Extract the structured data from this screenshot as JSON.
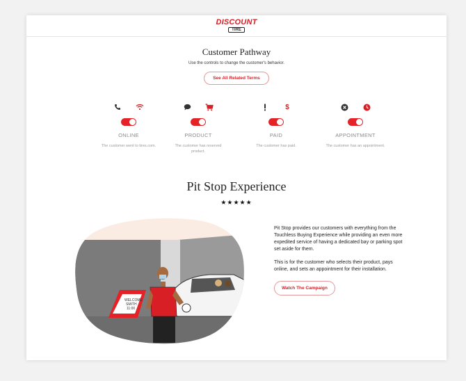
{
  "brand": {
    "logo_top": "DISCOUNT",
    "logo_bottom": "TIRE",
    "accent": "#d91f26"
  },
  "pathway": {
    "title": "Customer Pathway",
    "subtitle": "Use the controls to change the customer's behavior.",
    "terms_button": "See All Related Terms"
  },
  "stages": [
    {
      "label": "ONLINE",
      "desc": "The customer went to tires.com.",
      "icons": [
        "phone-icon",
        "wifi-icon"
      ],
      "toggle_on": true
    },
    {
      "label": "PRODUCT",
      "desc": "The customer has reserved product.",
      "icons": [
        "chat-bubble-icon",
        "cart-icon"
      ],
      "toggle_on": true
    },
    {
      "label": "PAID",
      "desc": "The customer has paid.",
      "icons": [
        "exclamation-icon",
        "dollar-icon"
      ],
      "toggle_on": true
    },
    {
      "label": "APPOINTMENT",
      "desc": "The customer has an appointment.",
      "icons": [
        "close-circle-icon",
        "clock-icon"
      ],
      "toggle_on": true
    }
  ],
  "experience": {
    "title": "Pit Stop Experience",
    "stars": "★★★★★",
    "paragraph1": "Pit Stop provides our customers with everything from the Touchless Buying Experience while providing an even more expedited service of having a dedicated bay or parking spot set aside for them.",
    "paragraph2": "This is for the customer who selects their product, pays online, and sets an appointment for their installation.",
    "campaign_button": "Watch The Campaign",
    "sign_line1": "WELCOME",
    "sign_line2": "SMITH",
    "sign_line3": "11:00"
  }
}
